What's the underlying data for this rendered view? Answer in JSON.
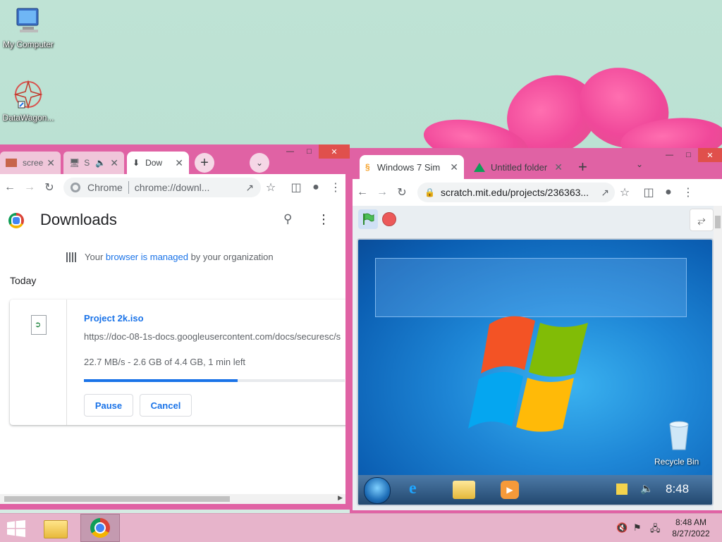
{
  "desktop": {
    "icons": [
      {
        "label": "My Computer",
        "icon": "computer-icon"
      },
      {
        "label": "DataWagon...",
        "icon": "datawagon-icon"
      }
    ]
  },
  "left_window": {
    "tabs": [
      {
        "label": "scree",
        "icon": "image-favicon"
      },
      {
        "label": "S",
        "icon": "monitor-icon",
        "audio": true
      },
      {
        "label": "Dow",
        "icon": "download-icon",
        "active": true
      }
    ],
    "omnibox": {
      "site_label": "Chrome",
      "url": "chrome://downl..."
    },
    "page": {
      "title": "Downloads",
      "managed_prefix": "Your ",
      "managed_link": "browser is managed",
      "managed_suffix": " by your organization",
      "section_label": "Today",
      "download": {
        "file_name": "Project 2k.iso",
        "url": "https://doc-08-1s-docs.googleusercontent.com/docs/securesc/s",
        "status": "22.7 MB/s - 2.6 GB of 4.4 GB, 1 min left",
        "progress": 0.59,
        "pause_label": "Pause",
        "cancel_label": "Cancel"
      }
    }
  },
  "right_window": {
    "tabs": [
      {
        "label": "Windows 7 Sim",
        "icon": "scratch-favicon",
        "active": true
      },
      {
        "label": "Untitled folder",
        "icon": "drive-favicon"
      }
    ],
    "omnibox": {
      "url": "scratch.mit.edu/projects/236363..."
    },
    "stage": {
      "recycle_bin_label": "Recycle Bin",
      "clock": "8:48"
    }
  },
  "taskbar": {
    "time": "8:48 AM",
    "date": "8/27/2022"
  },
  "colors": {
    "accent": "#1a73e8",
    "window_frame": "#e067a3",
    "taskbar": "#e7b4cb"
  }
}
